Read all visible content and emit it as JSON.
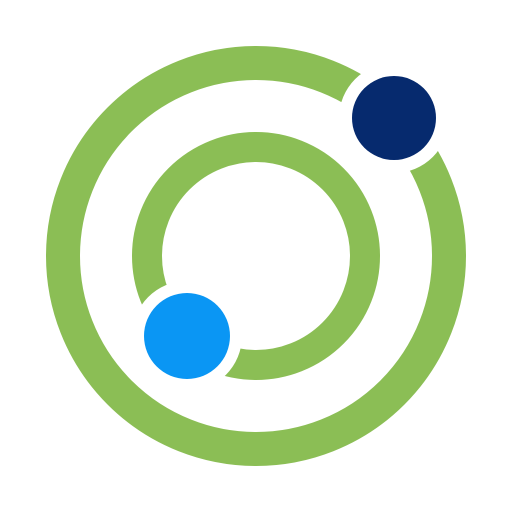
{
  "logo": {
    "name": "orbit-logo",
    "colors": {
      "rings": "#8BBE55",
      "outer_dot": "#062A6E",
      "inner_dot": "#0A96F4",
      "background": "#FFFFFF"
    },
    "icons": [
      "outer-ring-icon",
      "inner-ring-icon",
      "outer-orbit-dot-icon",
      "inner-orbit-dot-icon"
    ]
  }
}
